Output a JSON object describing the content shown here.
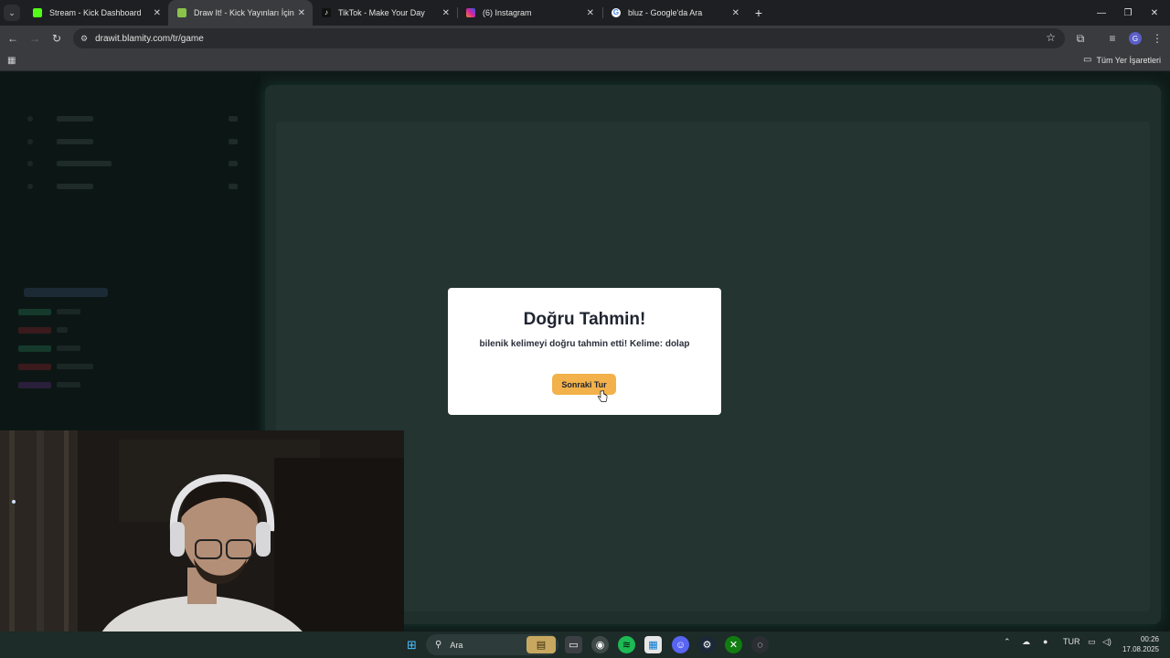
{
  "browser": {
    "tabs": [
      {
        "title": "Stream - Kick Dashboard",
        "favicon_color": "#53fc18",
        "favicon_glyph": "K",
        "active": false
      },
      {
        "title": "Draw It! - Kick Yayınları İçin Çiz",
        "favicon_color": "#8bc34a",
        "favicon_glyph": "✎",
        "active": true
      },
      {
        "title": "TikTok - Make Your Day",
        "favicon_color": "#111111",
        "favicon_glyph": "♪",
        "active": false
      },
      {
        "title": "(6) Instagram",
        "favicon_color": "#d6249f",
        "favicon_glyph": "◎",
        "active": false
      },
      {
        "title": "bluz - Google'da Ara",
        "favicon_color": "#ffffff",
        "favicon_glyph": "G",
        "active": false
      }
    ],
    "url": "drawit.blamity.com/tr/game",
    "profile_initial": "G",
    "bookmarks": {
      "all_bookmarks_label": "Tüm Yer İşaretleri"
    }
  },
  "modal": {
    "title": "Doğru Tahmin!",
    "message": "bilenik kelimeyi doğru tahmin etti! Kelime: dolap",
    "button_label": "Sonraki Tur",
    "button_color": "#f2b14a"
  },
  "taskbar": {
    "search_placeholder": "Ara",
    "language": "TUR",
    "time": "00:26",
    "date": "17.08.2025"
  }
}
